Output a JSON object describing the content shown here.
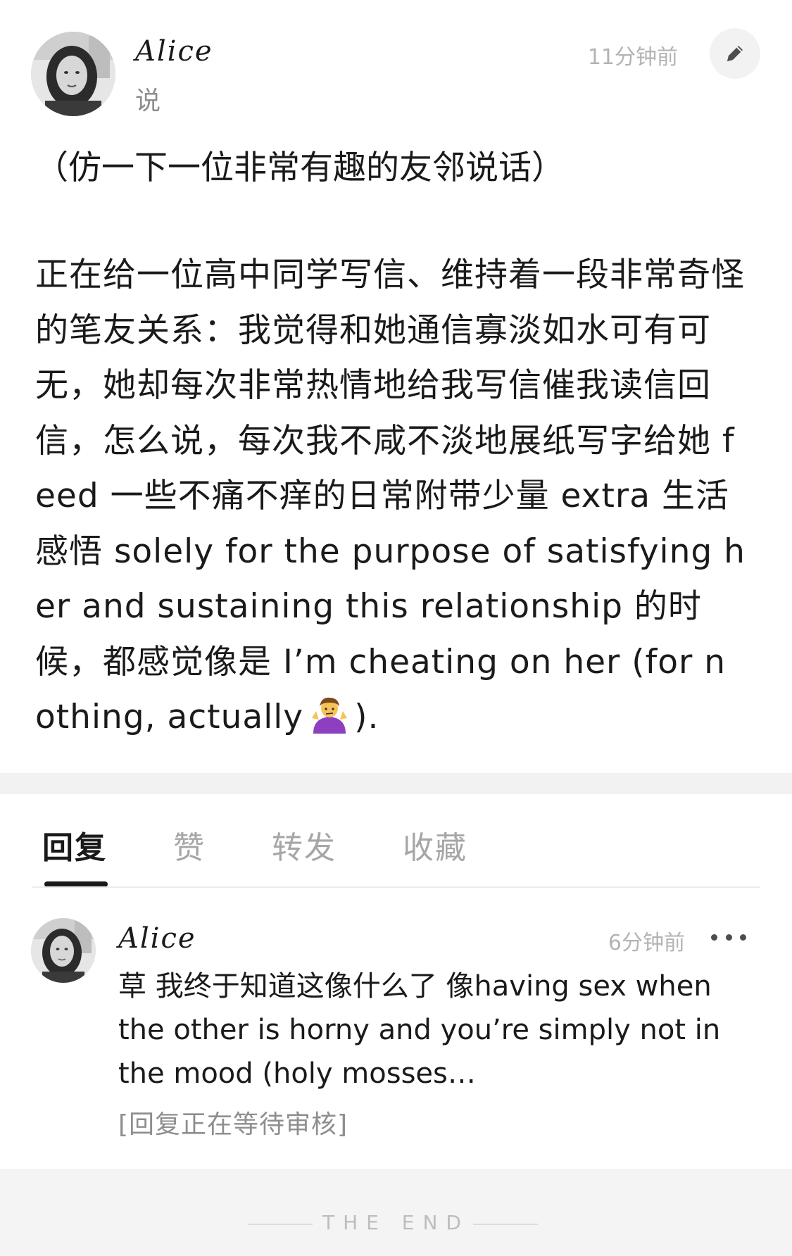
{
  "post": {
    "author": "Alice",
    "verb": "说",
    "time": "11分钟前",
    "edit_icon": "pencil-icon",
    "intro": "（仿一下一位非常有趣的友邻说话）",
    "body_before_emoji": "正在给一位高中同学写信、维持着一段非常奇怪的笔友关系：我觉得和她通信寡淡如水可有可无，她却每次非常热情地给我写信催我读信回信，怎么说，每次我不咸不淡地展纸写字给她 feed 一些不痛不痒的日常附带少量 extra 生活感悟 solely for the purpose of satisfying her and sustaining this relationship 的时候，都感觉像是 I’m cheating on her (for nothing, actually",
    "body_emoji": "person-shrugging-emoji",
    "body_after_emoji": ")."
  },
  "tabs": [
    {
      "label": "回复",
      "active": true
    },
    {
      "label": "赞",
      "active": false
    },
    {
      "label": "转发",
      "active": false
    },
    {
      "label": "收藏",
      "active": false
    }
  ],
  "reply": {
    "author": "Alice",
    "time": "6分钟前",
    "more_icon": "more-dots-icon",
    "text": "草 我终于知道这像什么了 像having sex when the other is horny and you’re simply not in the mood (holy mosses…",
    "status": "[回复正在等待审核]"
  },
  "footer": {
    "text": "THE END"
  },
  "colors": {
    "text_primary": "#1a1a1a",
    "text_muted": "#8e8e8e",
    "text_light": "#b3b3b3",
    "band": "#f2f2f2",
    "emoji_purple": "#8e3fbf",
    "emoji_skin": "#f5c35a"
  }
}
